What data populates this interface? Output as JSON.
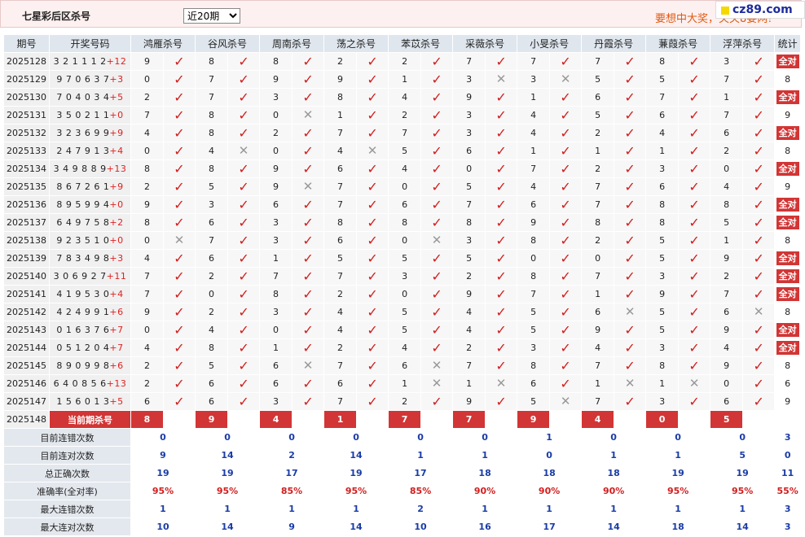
{
  "header": {
    "title": "七星彩后区杀号",
    "period_select": "近20期",
    "slogan": "要想中大奖，关关8要网!",
    "logo": "cz89.com"
  },
  "columns": {
    "issue": "期号",
    "draw": "开奖号码",
    "experts": [
      "鸿雁杀号",
      "谷风杀号",
      "周南杀号",
      "荡之杀号",
      "苯苡杀号",
      "采薇杀号",
      "小旻杀号",
      "丹霞杀号",
      "蒹葭杀号",
      "浮萍杀号"
    ],
    "stat": "统计"
  },
  "rows": [
    {
      "issue": "2025128",
      "draw": "3 2 1 1 1 2",
      "plus": "+12",
      "kills": [
        9,
        8,
        8,
        2,
        2,
        7,
        7,
        7,
        8,
        3
      ],
      "marks": [
        1,
        1,
        1,
        1,
        1,
        1,
        1,
        1,
        1,
        1
      ],
      "stat": "全对"
    },
    {
      "issue": "2025129",
      "draw": "9 7 0 6 3 7",
      "plus": "+3",
      "kills": [
        0,
        7,
        9,
        9,
        1,
        3,
        3,
        5,
        5,
        7
      ],
      "marks": [
        1,
        1,
        1,
        1,
        1,
        0,
        0,
        1,
        1,
        1
      ],
      "stat": "8"
    },
    {
      "issue": "2025130",
      "draw": "7 0 4 0 3 4",
      "plus": "+5",
      "kills": [
        2,
        7,
        3,
        8,
        4,
        9,
        1,
        6,
        7,
        1
      ],
      "marks": [
        1,
        1,
        1,
        1,
        1,
        1,
        1,
        1,
        1,
        1
      ],
      "stat": "全对"
    },
    {
      "issue": "2025131",
      "draw": "3 5 0 2 1 1",
      "plus": "+0",
      "kills": [
        7,
        8,
        0,
        1,
        2,
        3,
        4,
        5,
        6,
        7
      ],
      "marks": [
        1,
        1,
        0,
        1,
        1,
        1,
        1,
        1,
        1,
        1
      ],
      "stat": "9"
    },
    {
      "issue": "2025132",
      "draw": "3 2 3 6 9 9",
      "plus": "+9",
      "kills": [
        4,
        8,
        2,
        7,
        7,
        3,
        4,
        2,
        4,
        6
      ],
      "marks": [
        1,
        1,
        1,
        1,
        1,
        1,
        1,
        1,
        1,
        1
      ],
      "stat": "全对"
    },
    {
      "issue": "2025133",
      "draw": "2 4 7 9 1 3",
      "plus": "+4",
      "kills": [
        0,
        4,
        0,
        4,
        5,
        6,
        1,
        1,
        1,
        2
      ],
      "marks": [
        1,
        0,
        1,
        0,
        1,
        1,
        1,
        1,
        1,
        1
      ],
      "stat": "8"
    },
    {
      "issue": "2025134",
      "draw": "3 4 9 8 8 9",
      "plus": "+13",
      "kills": [
        8,
        8,
        9,
        6,
        4,
        0,
        7,
        2,
        3,
        0
      ],
      "marks": [
        1,
        1,
        1,
        1,
        1,
        1,
        1,
        1,
        1,
        1
      ],
      "stat": "全对"
    },
    {
      "issue": "2025135",
      "draw": "8 6 7 2 6 1",
      "plus": "+9",
      "kills": [
        2,
        5,
        9,
        7,
        0,
        5,
        4,
        7,
        6,
        4
      ],
      "marks": [
        1,
        1,
        0,
        1,
        1,
        1,
        1,
        1,
        1,
        1
      ],
      "stat": "9"
    },
    {
      "issue": "2025136",
      "draw": "8 9 5 9 9 4",
      "plus": "+0",
      "kills": [
        9,
        3,
        6,
        7,
        6,
        7,
        6,
        7,
        8,
        8
      ],
      "marks": [
        1,
        1,
        1,
        1,
        1,
        1,
        1,
        1,
        1,
        1
      ],
      "stat": "全对"
    },
    {
      "issue": "2025137",
      "draw": "6 4 9 7 5 8",
      "plus": "+2",
      "kills": [
        8,
        6,
        3,
        8,
        8,
        8,
        9,
        8,
        8,
        5
      ],
      "marks": [
        1,
        1,
        1,
        1,
        1,
        1,
        1,
        1,
        1,
        1
      ],
      "stat": "全对"
    },
    {
      "issue": "2025138",
      "draw": "9 2 3 5 1 0",
      "plus": "+0",
      "kills": [
        0,
        7,
        3,
        6,
        0,
        3,
        8,
        2,
        5,
        1
      ],
      "marks": [
        0,
        1,
        1,
        1,
        0,
        1,
        1,
        1,
        1,
        1
      ],
      "stat": "8"
    },
    {
      "issue": "2025139",
      "draw": "7 8 3 4 9 8",
      "plus": "+3",
      "kills": [
        4,
        6,
        1,
        5,
        5,
        5,
        0,
        0,
        5,
        9
      ],
      "marks": [
        1,
        1,
        1,
        1,
        1,
        1,
        1,
        1,
        1,
        1
      ],
      "stat": "全对"
    },
    {
      "issue": "2025140",
      "draw": "3 0 6 9 2 7",
      "plus": "+11",
      "kills": [
        7,
        2,
        7,
        7,
        3,
        2,
        8,
        7,
        3,
        2
      ],
      "marks": [
        1,
        1,
        1,
        1,
        1,
        1,
        1,
        1,
        1,
        1
      ],
      "stat": "全对"
    },
    {
      "issue": "2025141",
      "draw": "4 1 9 5 3 0",
      "plus": "+4",
      "kills": [
        7,
        0,
        8,
        2,
        0,
        9,
        7,
        1,
        9,
        7
      ],
      "marks": [
        1,
        1,
        1,
        1,
        1,
        1,
        1,
        1,
        1,
        1
      ],
      "stat": "全对"
    },
    {
      "issue": "2025142",
      "draw": "4 2 4 9 9 1",
      "plus": "+6",
      "kills": [
        9,
        2,
        3,
        4,
        5,
        4,
        5,
        6,
        5,
        6
      ],
      "marks": [
        1,
        1,
        1,
        1,
        1,
        1,
        1,
        0,
        1,
        0
      ],
      "stat": "8"
    },
    {
      "issue": "2025143",
      "draw": "0 1 6 3 7 6",
      "plus": "+7",
      "kills": [
        0,
        4,
        0,
        4,
        5,
        4,
        5,
        9,
        5,
        9
      ],
      "marks": [
        1,
        1,
        1,
        1,
        1,
        1,
        1,
        1,
        1,
        1
      ],
      "stat": "全对"
    },
    {
      "issue": "2025144",
      "draw": "0 5 1 2 0 4",
      "plus": "+7",
      "kills": [
        4,
        8,
        1,
        2,
        4,
        2,
        3,
        4,
        3,
        4
      ],
      "marks": [
        1,
        1,
        1,
        1,
        1,
        1,
        1,
        1,
        1,
        1
      ],
      "stat": "全对"
    },
    {
      "issue": "2025145",
      "draw": "8 9 0 9 9 8",
      "plus": "+6",
      "kills": [
        2,
        5,
        6,
        7,
        6,
        7,
        8,
        7,
        8,
        9
      ],
      "marks": [
        1,
        1,
        0,
        1,
        0,
        1,
        1,
        1,
        1,
        1
      ],
      "stat": "8"
    },
    {
      "issue": "2025146",
      "draw": "6 4 0 8 5 6",
      "plus": "+13",
      "kills": [
        2,
        6,
        6,
        6,
        1,
        1,
        6,
        1,
        1,
        0
      ],
      "marks": [
        1,
        1,
        1,
        1,
        0,
        0,
        1,
        0,
        0,
        1
      ],
      "stat": "6"
    },
    {
      "issue": "2025147",
      "draw": "1 5 6 0 1 3",
      "plus": "+5",
      "kills": [
        6,
        6,
        3,
        7,
        2,
        9,
        5,
        7,
        3,
        6
      ],
      "marks": [
        1,
        1,
        1,
        1,
        1,
        1,
        0,
        1,
        1,
        1
      ],
      "stat": "9"
    }
  ],
  "current": {
    "issue": "2025148",
    "label": "当前期杀号",
    "kills": [
      "8",
      "9",
      "4",
      "1",
      "7",
      "7",
      "9",
      "4",
      "0",
      "5"
    ]
  },
  "summary": [
    {
      "label": "目前连错次数",
      "values": [
        "0",
        "0",
        "0",
        "0",
        "0",
        "0",
        "1",
        "0",
        "0",
        "0",
        "3"
      ],
      "red": false
    },
    {
      "label": "目前连对次数",
      "values": [
        "9",
        "14",
        "2",
        "14",
        "1",
        "1",
        "0",
        "1",
        "1",
        "5",
        "0"
      ],
      "red": false
    },
    {
      "label": "总正确次数",
      "values": [
        "19",
        "19",
        "17",
        "19",
        "17",
        "18",
        "18",
        "18",
        "19",
        "19",
        "11"
      ],
      "red": false
    },
    {
      "label": "准确率(全对率)",
      "values": [
        "95%",
        "95%",
        "85%",
        "95%",
        "85%",
        "90%",
        "90%",
        "90%",
        "95%",
        "95%",
        "55%"
      ],
      "red": true
    },
    {
      "label": "最大连错次数",
      "values": [
        "1",
        "1",
        "1",
        "1",
        "2",
        "1",
        "1",
        "1",
        "1",
        "1",
        "3"
      ],
      "red": false
    },
    {
      "label": "最大连对次数",
      "values": [
        "10",
        "14",
        "9",
        "14",
        "10",
        "16",
        "17",
        "14",
        "18",
        "14",
        "3"
      ],
      "red": false
    }
  ],
  "colors": {
    "accent_red": "#d23535",
    "check_red": "#d21e1e",
    "summary_blue": "#1a3ca6",
    "slogan_orange": "#e05a10"
  }
}
